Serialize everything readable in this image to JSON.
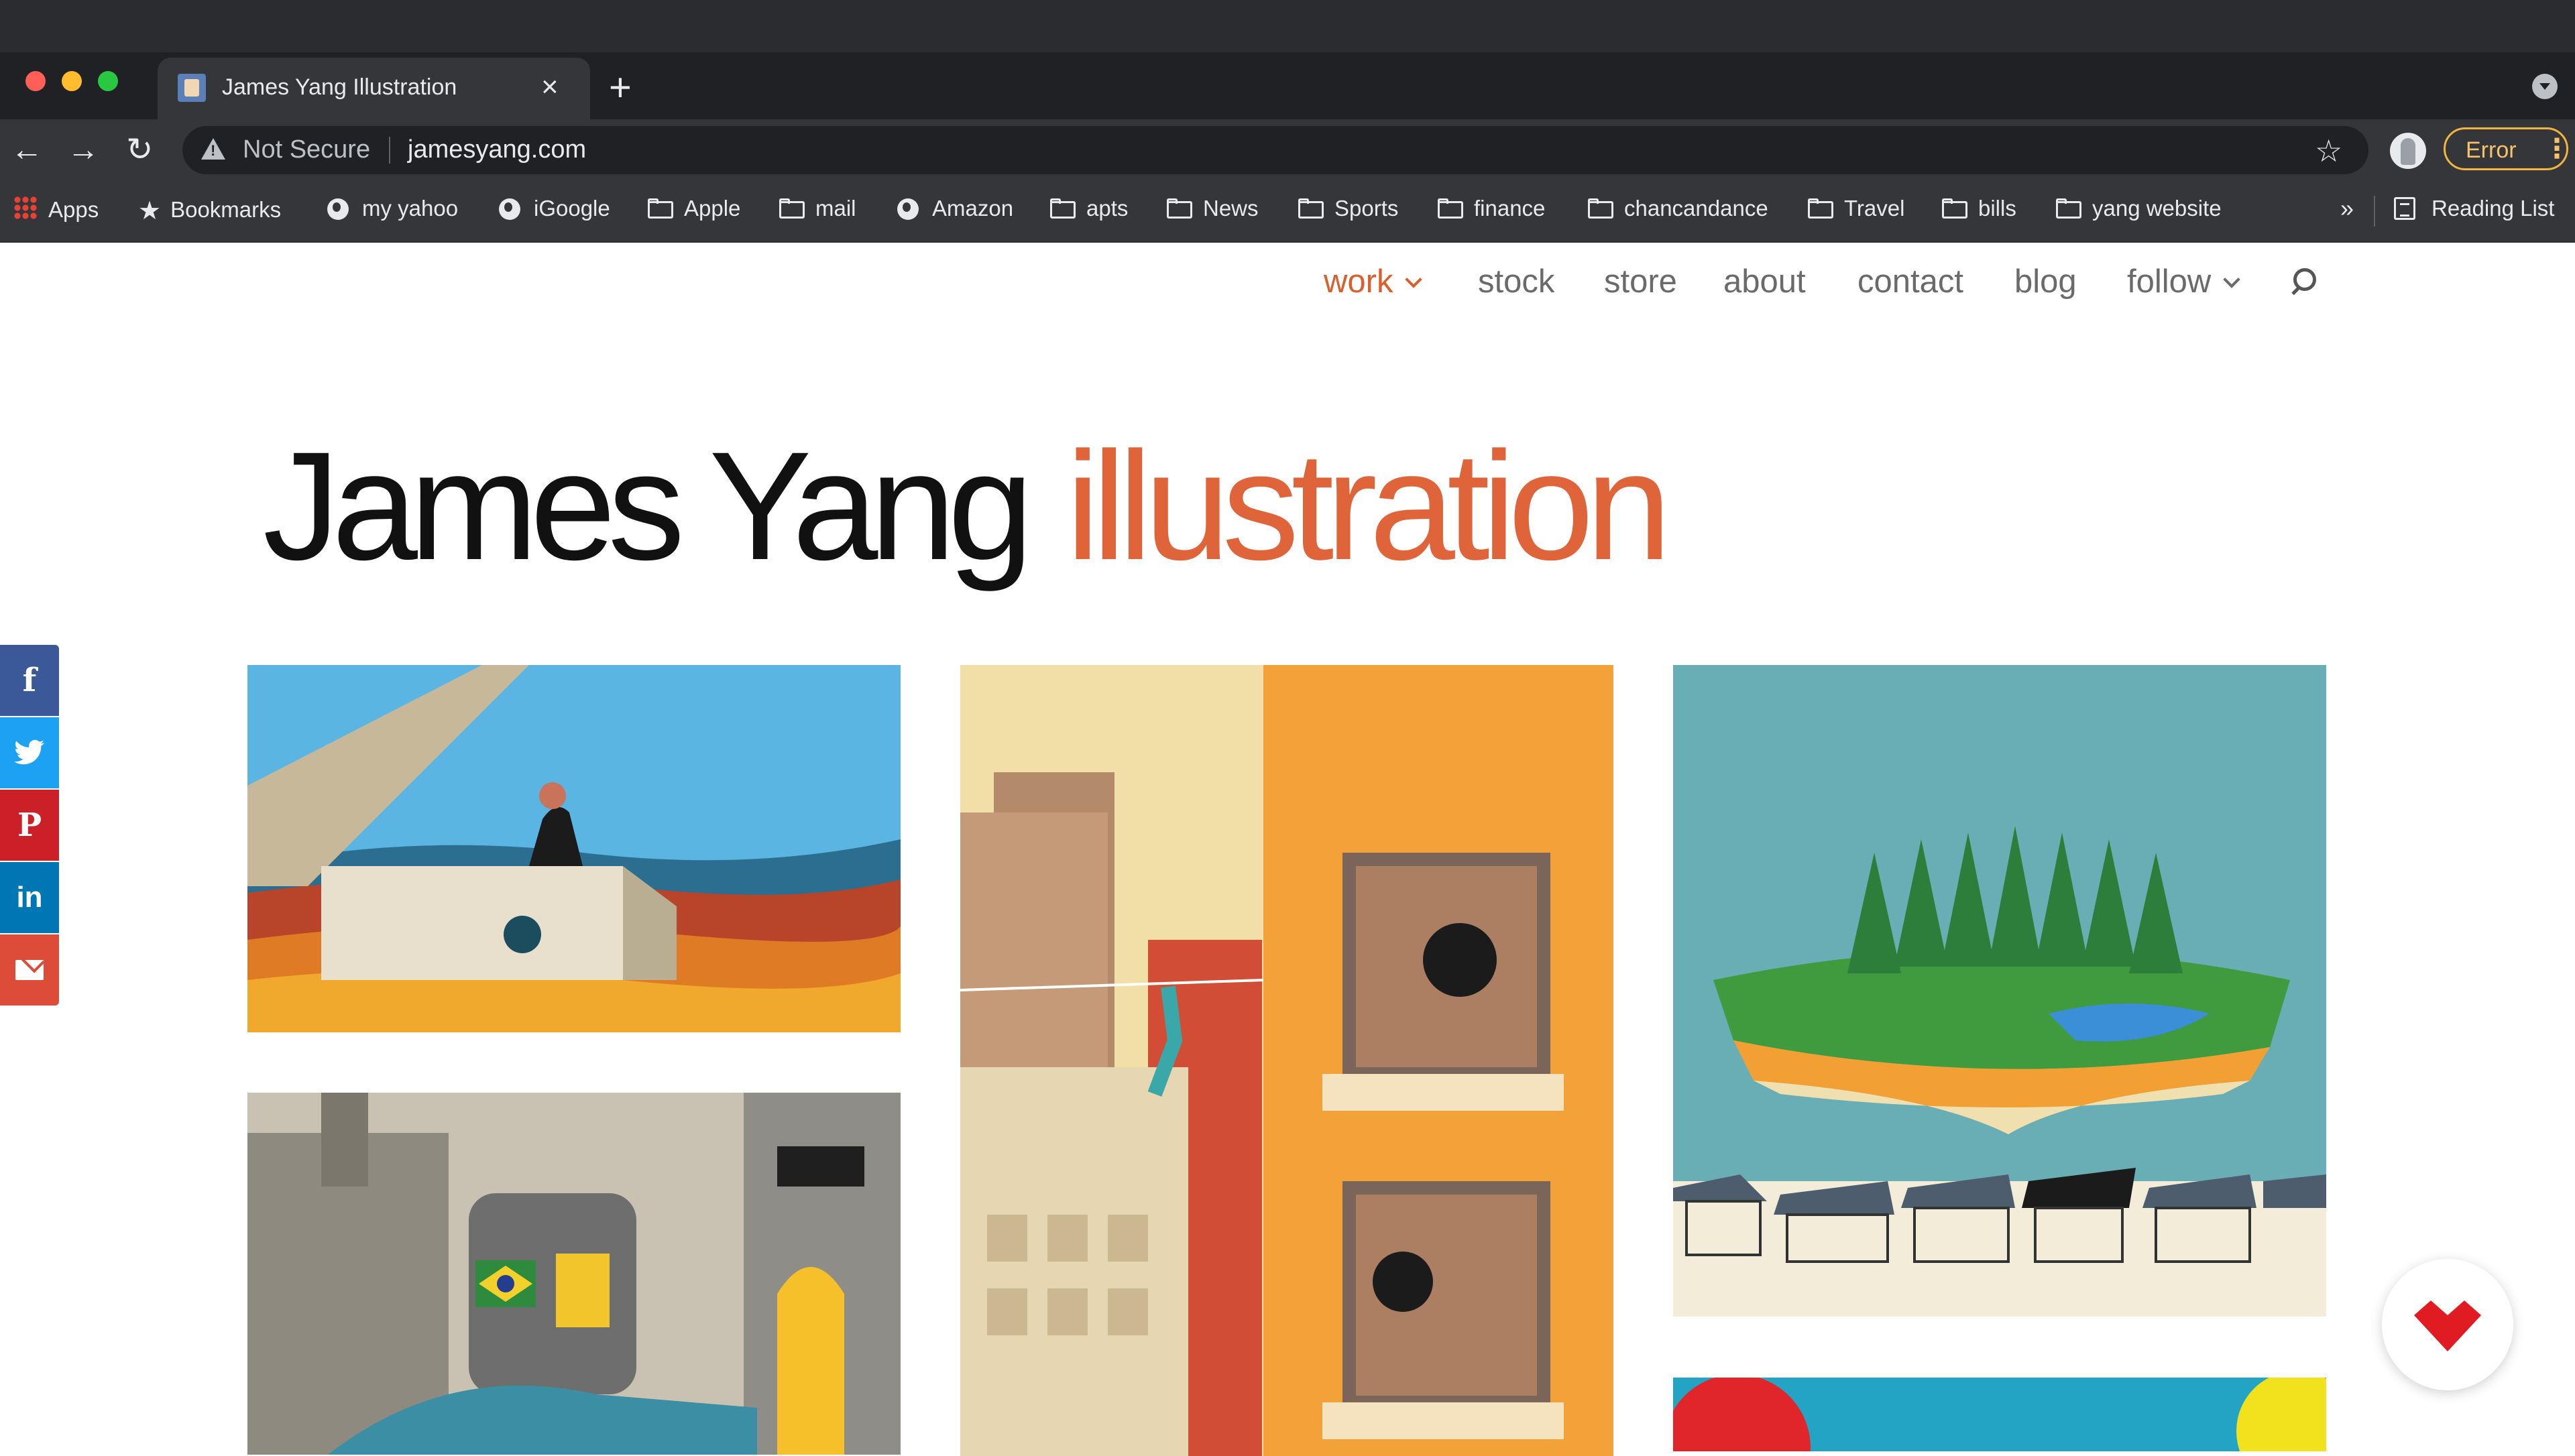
{
  "browser": {
    "tab_title": "James Yang Illustration",
    "tab_close": "×",
    "new_tab": "+",
    "nav": {
      "back": "←",
      "forward": "→",
      "reload": "↻"
    },
    "omnibox": {
      "security": "Not Secure",
      "url": "jamesyang.com",
      "star": "☆"
    },
    "error_label": "Error",
    "menu_dots": "⋮",
    "bookmarks": [
      {
        "label": "Apps",
        "icon": "apps-grid-icon"
      },
      {
        "label": "Bookmarks",
        "icon": "star-icon"
      },
      {
        "label": "my yahoo",
        "icon": "globe-icon"
      },
      {
        "label": "iGoogle",
        "icon": "globe-icon"
      },
      {
        "label": "Apple",
        "icon": "folder-icon"
      },
      {
        "label": "mail",
        "icon": "folder-icon"
      },
      {
        "label": "Amazon",
        "icon": "globe-icon"
      },
      {
        "label": "apts",
        "icon": "folder-icon"
      },
      {
        "label": "News",
        "icon": "folder-icon"
      },
      {
        "label": "Sports",
        "icon": "folder-icon"
      },
      {
        "label": "finance",
        "icon": "folder-icon"
      },
      {
        "label": "chancandance",
        "icon": "folder-icon"
      },
      {
        "label": "Travel",
        "icon": "folder-icon"
      },
      {
        "label": "bills",
        "icon": "folder-icon"
      },
      {
        "label": "yang website",
        "icon": "folder-icon"
      }
    ],
    "bookmarks_overflow": "»",
    "reading_list": "Reading List"
  },
  "site": {
    "nav": {
      "work": "work",
      "stock": "stock",
      "store": "store",
      "about": "about",
      "contact": "contact",
      "blog": "blog",
      "follow": "follow"
    },
    "logo": {
      "name": "James Yang",
      "word": "illustration"
    },
    "share": {
      "facebook": "f",
      "pinterest": "P",
      "linkedin": "in"
    },
    "colors": {
      "accent": "#d8602e",
      "logo_orange": "#e0643a",
      "nav_gray": "#6a6a6a"
    }
  }
}
